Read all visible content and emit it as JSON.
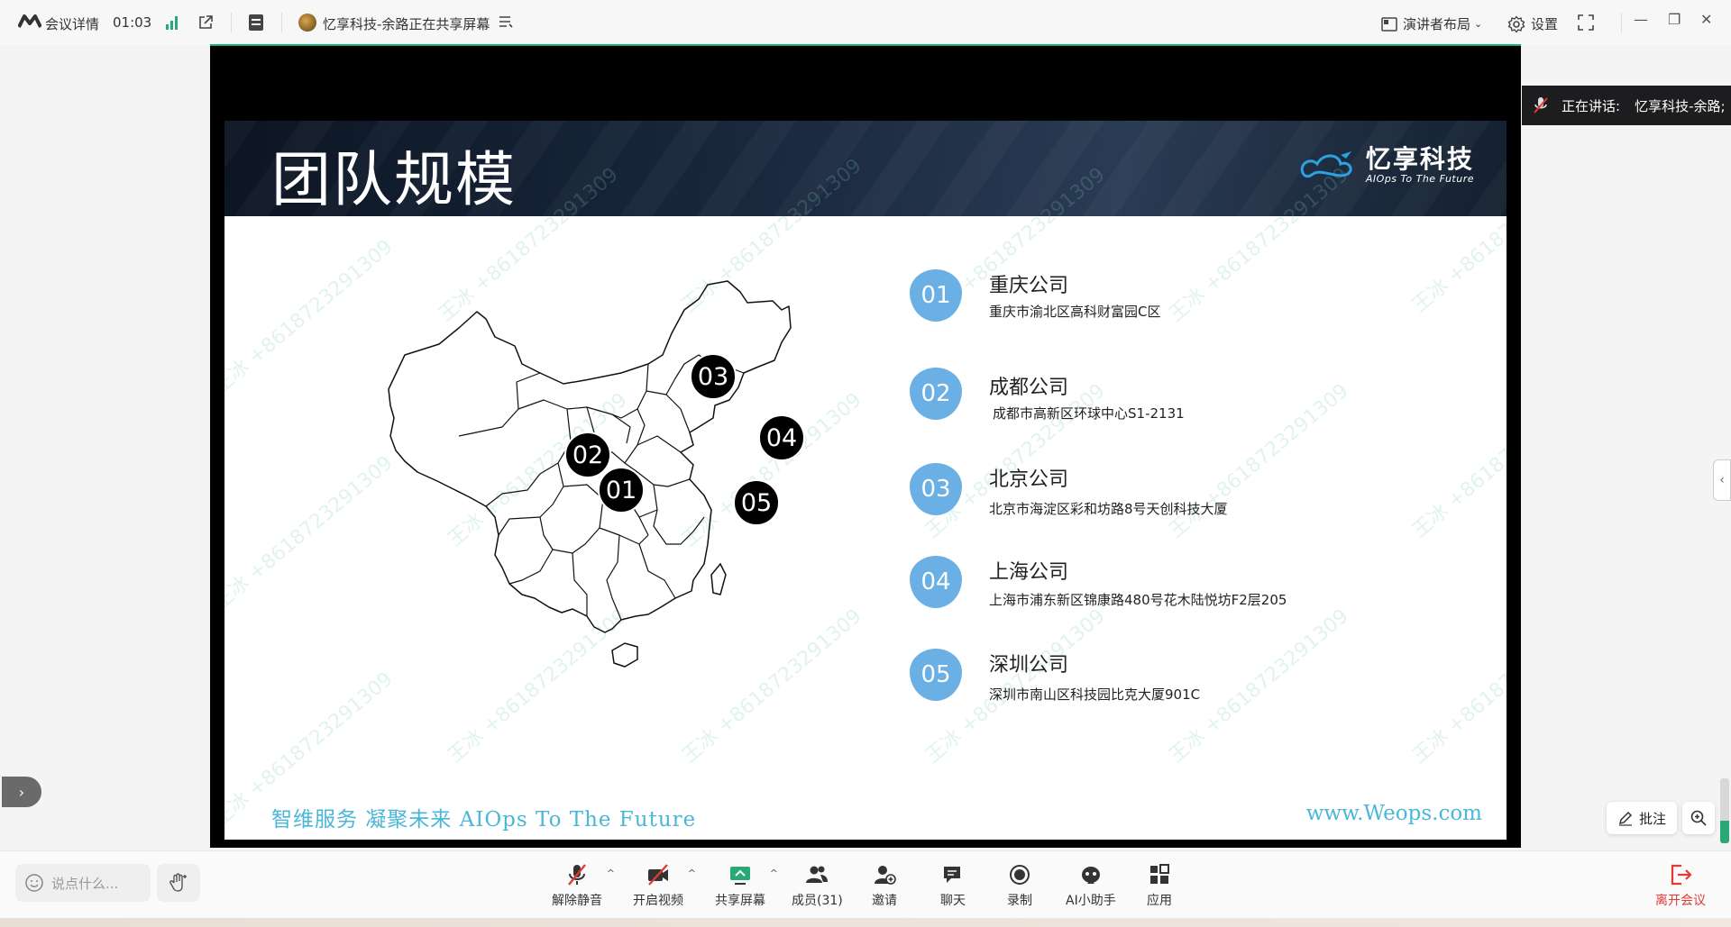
{
  "topbar": {
    "meeting_details": "会议详情",
    "elapsed": "01:03",
    "share_title": "忆享科技-余路正在共享屏幕",
    "layout_label": "演讲者布局",
    "settings_label": "设置"
  },
  "speaking": {
    "label": "正在讲话:",
    "name": "忆享科技-余路;"
  },
  "slide": {
    "title": "团队规模",
    "brand_name": "忆享科技",
    "brand_sub": "AIOps To The Future",
    "slogan": "智维服务 凝聚未来  AIOps To The Future",
    "website": "www.Weops.com",
    "watermark": "王冰 +8618723291309",
    "map_badges": [
      "01",
      "02",
      "03",
      "04",
      "05"
    ],
    "locations": [
      {
        "num": "01",
        "name": "重庆公司",
        "address": "重庆市渝北区高科财富园C区"
      },
      {
        "num": "02",
        "name": "成都公司",
        "address": "成都市高新区环球中心S1-2131"
      },
      {
        "num": "03",
        "name": "北京公司",
        "address": "北京市海淀区彩和坊路8号天创科技大厦"
      },
      {
        "num": "04",
        "name": "上海公司",
        "address": "上海市浦东新区锦康路480号花木陆悦坊F2层205"
      },
      {
        "num": "05",
        "name": "深圳公司",
        "address": "深圳市南山区科技园比克大厦901C"
      }
    ]
  },
  "overlay": {
    "annotate_label": "批注"
  },
  "bottombar": {
    "chat_placeholder": "说点什么...",
    "unmute": "解除静音",
    "video": "开启视频",
    "share": "共享屏幕",
    "members": "成员(31)",
    "invite": "邀请",
    "chat": "聊天",
    "record": "录制",
    "ai": "AI小助手",
    "apps": "应用",
    "leave": "离开会议"
  },
  "colors": {
    "accent_green": "#18b277",
    "slide_blue": "#6bb0e4",
    "slogan_teal": "#4ab7d8",
    "leave_red": "#e03c31"
  },
  "audio_level": 0.35
}
